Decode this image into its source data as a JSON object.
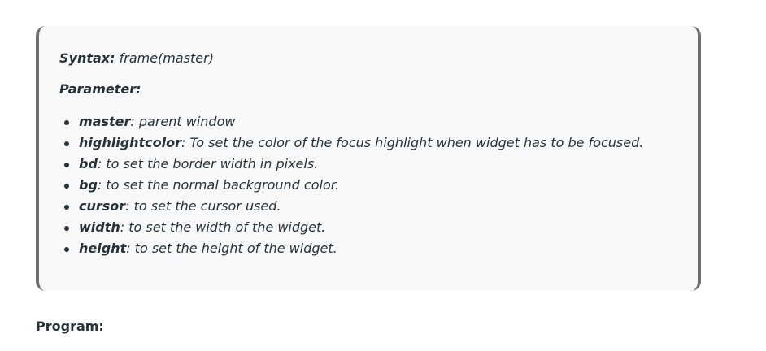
{
  "note": {
    "syntax_label": "Syntax:",
    "syntax_value": " frame(master)",
    "parameter_label": "Parameter:",
    "params": [
      {
        "name": "master",
        "desc": ": parent window"
      },
      {
        "name": "highlightcolor",
        "desc": ": To set the color of the focus highlight when widget has to be focused."
      },
      {
        "name": "bd",
        "desc": ": to set the border width in pixels."
      },
      {
        "name": "bg",
        "desc": ": to set the normal background color."
      },
      {
        "name": "cursor",
        "desc": ": to set the cursor used."
      },
      {
        "name": "width",
        "desc": ": to set the width of the widget."
      },
      {
        "name": "height",
        "desc": ": to set the height of the widget."
      }
    ]
  },
  "program_heading": "Program:"
}
